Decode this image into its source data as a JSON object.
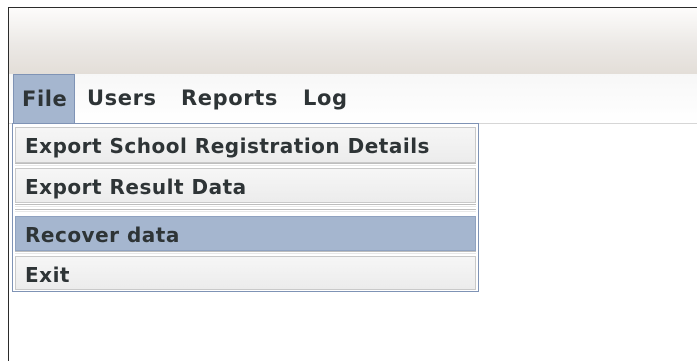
{
  "menubar": {
    "menus": [
      {
        "label": "File"
      },
      {
        "label": "Users"
      },
      {
        "label": "Reports"
      },
      {
        "label": "Log"
      }
    ]
  },
  "file_menu": {
    "items": [
      {
        "label": "Export School Registration Details"
      },
      {
        "label": "Export Result Data"
      },
      {
        "label": "Recover data"
      },
      {
        "label": "Exit"
      }
    ],
    "selected_item": "Recover data"
  },
  "colors": {
    "highlight": "#a5b6cf",
    "text": "#2e3436"
  }
}
